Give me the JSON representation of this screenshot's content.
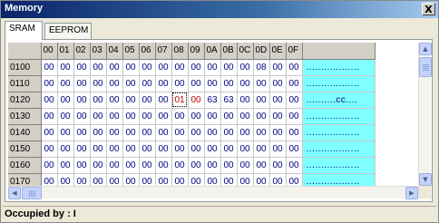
{
  "window": {
    "title": "Memory",
    "close_label": "X"
  },
  "tabs": [
    {
      "label": "SRAM"
    },
    {
      "label": "EEPROM"
    }
  ],
  "columns": [
    "00",
    "01",
    "02",
    "03",
    "04",
    "05",
    "06",
    "07",
    "08",
    "09",
    "0A",
    "0B",
    "0C",
    "0D",
    "0E",
    "0F"
  ],
  "rows": [
    {
      "addr": "0100",
      "values": [
        "00",
        "00",
        "00",
        "00",
        "00",
        "00",
        "00",
        "00",
        "00",
        "00",
        "00",
        "00",
        "00",
        "08",
        "00",
        "00"
      ],
      "ascii": ".................."
    },
    {
      "addr": "0110",
      "values": [
        "00",
        "00",
        "00",
        "00",
        "00",
        "00",
        "00",
        "00",
        "00",
        "00",
        "00",
        "00",
        "00",
        "00",
        "00",
        "00"
      ],
      "ascii": ".................."
    },
    {
      "addr": "0120",
      "values": [
        "00",
        "00",
        "00",
        "00",
        "00",
        "00",
        "00",
        "00",
        "01",
        "00",
        "63",
        "63",
        "00",
        "00",
        "00",
        "00"
      ],
      "ascii": "..........cc...."
    },
    {
      "addr": "0130",
      "values": [
        "00",
        "00",
        "00",
        "00",
        "00",
        "00",
        "00",
        "00",
        "00",
        "00",
        "00",
        "00",
        "00",
        "00",
        "00",
        "00"
      ],
      "ascii": ".................."
    },
    {
      "addr": "0140",
      "values": [
        "00",
        "00",
        "00",
        "00",
        "00",
        "00",
        "00",
        "00",
        "00",
        "00",
        "00",
        "00",
        "00",
        "00",
        "00",
        "00"
      ],
      "ascii": ".................."
    },
    {
      "addr": "0150",
      "values": [
        "00",
        "00",
        "00",
        "00",
        "00",
        "00",
        "00",
        "00",
        "00",
        "00",
        "00",
        "00",
        "00",
        "00",
        "00",
        "00"
      ],
      "ascii": ".................."
    },
    {
      "addr": "0160",
      "values": [
        "00",
        "00",
        "00",
        "00",
        "00",
        "00",
        "00",
        "00",
        "00",
        "00",
        "00",
        "00",
        "00",
        "00",
        "00",
        "00"
      ],
      "ascii": ".................."
    },
    {
      "addr": "0170",
      "values": [
        "00",
        "00",
        "00",
        "00",
        "00",
        "00",
        "00",
        "00",
        "00",
        "00",
        "00",
        "00",
        "00",
        "00",
        "00",
        "00"
      ],
      "ascii": ".................."
    }
  ],
  "highlight": {
    "changed": [
      [
        2,
        8
      ],
      [
        2,
        9
      ]
    ],
    "selected": [
      2,
      8
    ],
    "changed_color": "#c00000",
    "value_color": "#000080",
    "ascii_bg": "#7fffff"
  },
  "status": {
    "text": "Occupied by : I"
  }
}
